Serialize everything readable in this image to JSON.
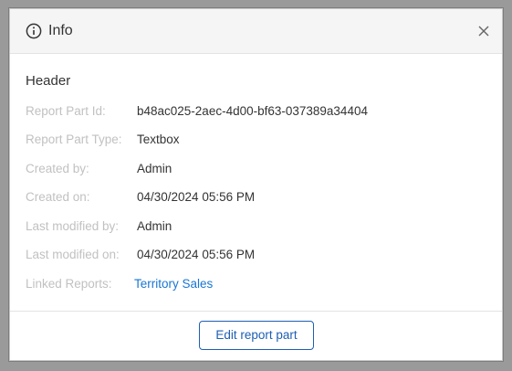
{
  "dialog": {
    "title": "Info",
    "icon": "info-icon",
    "close_icon": "close-icon"
  },
  "section": {
    "title": "Header"
  },
  "fields": [
    {
      "label": "Report Part Id:",
      "value": "b48ac025-2aec-4d00-bf63-037389a34404"
    },
    {
      "label": "Report Part Type:",
      "value": "Textbox"
    },
    {
      "label": "Created by:",
      "value": "Admin"
    },
    {
      "label": "Created on:",
      "value": "04/30/2024 05:56 PM"
    },
    {
      "label": "Last modified by:",
      "value": "Admin"
    },
    {
      "label": "Last modified on:",
      "value": "04/30/2024 05:56 PM"
    },
    {
      "label": "Linked Reports:",
      "value": "Territory Sales"
    }
  ],
  "footer": {
    "edit_label": "Edit report part"
  },
  "colors": {
    "label": "#c1c1c1",
    "value": "#333333",
    "link": "#1976d2",
    "button_accent": "#1e5fb3"
  }
}
